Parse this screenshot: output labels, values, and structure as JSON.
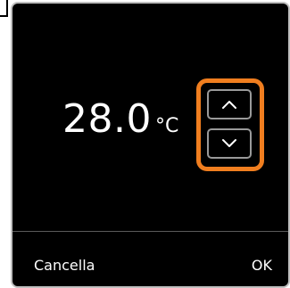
{
  "dialog": {
    "temperature_value": "28.0",
    "temperature_unit": "°C",
    "stepper": {
      "up_icon": "chevron-up-icon",
      "down_icon": "chevron-down-icon",
      "highlight_color": "#f07e1f"
    },
    "footer": {
      "cancel_label": "Cancella",
      "ok_label": "OK"
    }
  }
}
